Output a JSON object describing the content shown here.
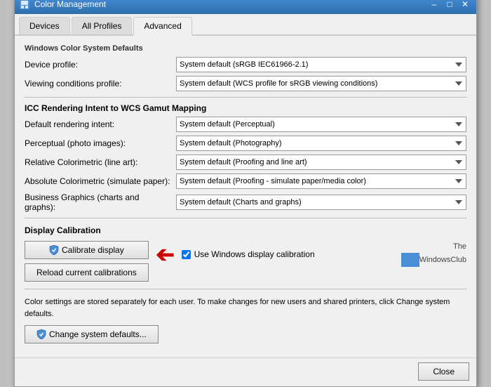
{
  "window": {
    "title": "Color Management",
    "tabs": [
      {
        "id": "devices",
        "label": "Devices",
        "active": false
      },
      {
        "id": "all-profiles",
        "label": "All Profiles",
        "active": false
      },
      {
        "id": "advanced",
        "label": "Advanced",
        "active": true
      }
    ]
  },
  "advanced": {
    "section1_title": "Windows Color System Defaults",
    "device_profile_label": "Device profile:",
    "device_profile_value": "System default (sRGB IEC61966-2.1)",
    "viewing_conditions_label": "Viewing conditions profile:",
    "viewing_conditions_value": "System default (WCS profile for sRGB viewing conditions)",
    "section2_title": "ICC Rendering Intent to WCS Gamut Mapping",
    "default_rendering_label": "Default rendering intent:",
    "default_rendering_value": "System default (Perceptual)",
    "perceptual_label": "Perceptual (photo images):",
    "perceptual_value": "System default (Photography)",
    "relative_label": "Relative Colorimetric (line art):",
    "relative_value": "System default (Proofing and line art)",
    "absolute_label": "Absolute Colorimetric (simulate paper):",
    "absolute_value": "System default (Proofing - simulate paper/media color)",
    "business_label": "Business Graphics (charts and graphs):",
    "business_value": "System default (Charts and graphs)",
    "calibration_title": "Display Calibration",
    "calibrate_btn": "Calibrate display",
    "reload_btn": "Reload current calibrations",
    "use_windows_calibration": "Use Windows display calibration",
    "bottom_text": "Color settings are stored separately for each user. To make changes for new users and shared printers, click Change system defaults.",
    "change_defaults_btn": "Change system defaults...",
    "close_btn": "Close",
    "watermark_line1": "The",
    "watermark_line2": "WindowsClub"
  }
}
